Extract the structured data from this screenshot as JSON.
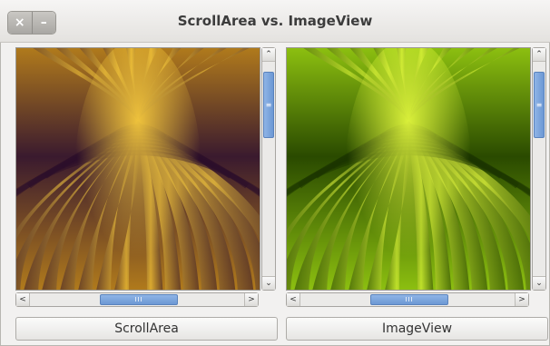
{
  "window": {
    "title": "ScrollArea vs. ImageView",
    "close_glyph": "×",
    "minimize_glyph": "–"
  },
  "panes": [
    {
      "name": "ScrollArea",
      "button_label": "ScrollArea",
      "palette": {
        "base": "#3a1a2e",
        "mid": "#b07a1c",
        "light": "#ffd23e",
        "dark": "#2c0f2a"
      }
    },
    {
      "name": "ImageView",
      "button_label": "ImageView",
      "palette": {
        "base": "#2a4a00",
        "mid": "#8cbf10",
        "light": "#eaff40",
        "dark": "#1c3400"
      }
    }
  ],
  "scrollbar": {
    "up_glyph": "⌃",
    "down_glyph": "⌄",
    "left_glyph": "<",
    "right_glyph": ">",
    "vgrip": "≡",
    "hgrip": "III"
  }
}
